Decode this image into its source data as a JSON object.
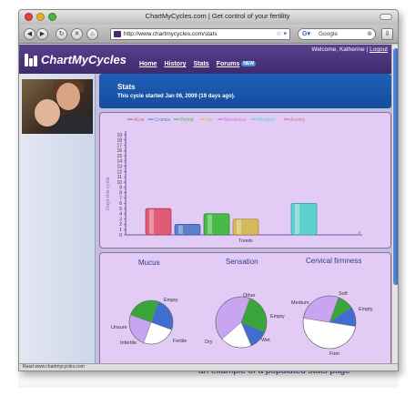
{
  "window": {
    "title": "ChartMyCycles.com | Get control of your fertility",
    "url": "http://www.chartmycycles.com/stats",
    "search_placeholder": "Google",
    "status": "Read www.chartmycycles.com"
  },
  "site": {
    "logo_text": "ChartMyCycles",
    "welcome": "Welcome, Katherine",
    "logout": "Logout",
    "nav": [
      "Home",
      "History",
      "Stats",
      "Forums"
    ],
    "new_badge": "NEW",
    "brand_color": "#4a2f86"
  },
  "stats": {
    "title": "Stats",
    "subtitle": "This cycle started Jan 06, 2009 (19 days ago)."
  },
  "chart_data": [
    {
      "type": "bar",
      "ylabel": "Days this cycle",
      "xlabel": "Trends",
      "ylim": [
        0,
        19
      ],
      "yticks": [
        0,
        1,
        2,
        3,
        4,
        5,
        6,
        7,
        8,
        9,
        10,
        11,
        12,
        13,
        14,
        15,
        16,
        17,
        18,
        19
      ],
      "legend": [
        "Acne",
        "Cramps",
        "Period",
        "Sex",
        "Moodiness",
        "Allergies",
        "Anxiety"
      ],
      "colors": [
        "#e05b78",
        "#5d7fd0",
        "#49b949",
        "#d4b85a",
        "#c67ad8",
        "#5fd0d0",
        "#d87a7a"
      ],
      "values": [
        5,
        2,
        4,
        3,
        0,
        6,
        0
      ]
    },
    {
      "type": "pie",
      "title": "Mucus",
      "labels": [
        "Empty",
        "Fertile",
        "Infertile",
        "Unsure"
      ],
      "colors": [
        "#3f6ed1",
        "#ffffff",
        "#c9a4f0",
        "#3aa53a"
      ],
      "values": [
        25,
        25,
        25,
        25
      ]
    },
    {
      "type": "pie",
      "title": "Sensation",
      "labels": [
        "Other",
        "Empty",
        "Wet",
        "Dry"
      ],
      "colors": [
        "#3aa53a",
        "#3f6ed1",
        "#ffffff",
        "#c9a4f0"
      ],
      "values": [
        26,
        12,
        20,
        42
      ]
    },
    {
      "type": "pie",
      "title": "Cervical firmness",
      "labels": [
        "Soft",
        "Empty",
        "Firm",
        "Medium"
      ],
      "colors": [
        "#3aa53a",
        "#3f6ed1",
        "#ffffff",
        "#c9a4f0"
      ],
      "values": [
        10,
        12,
        50,
        28
      ]
    }
  ],
  "caption": "an example of a populated stats page"
}
